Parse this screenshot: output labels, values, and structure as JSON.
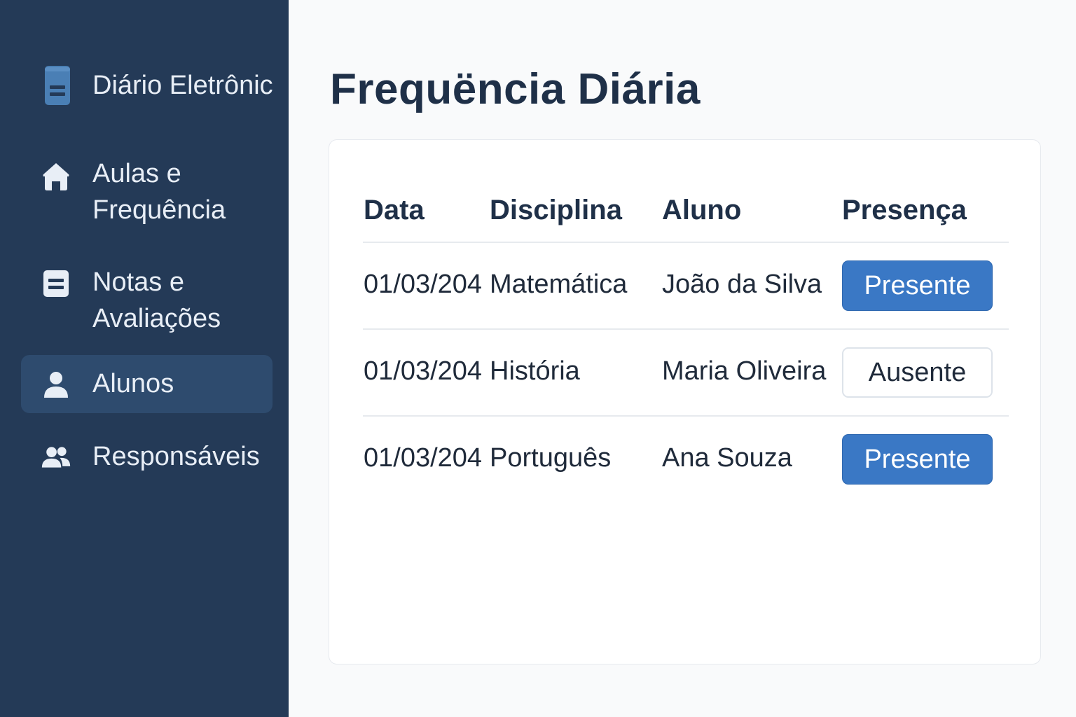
{
  "sidebar": {
    "brand": {
      "title": "Diário Eletrônic",
      "icon": "notebook-icon"
    },
    "items": [
      {
        "lines": [
          "Aulas e",
          "Frequência"
        ],
        "icon": "home-icon",
        "active": false
      },
      {
        "lines": [
          "Notas e",
          "Avaliações"
        ],
        "icon": "document-list-icon",
        "active": false
      },
      {
        "lines": [
          "Alunos"
        ],
        "icon": "user-icon",
        "active": true
      },
      {
        "lines": [
          "Responsáveis"
        ],
        "icon": "users-icon",
        "active": false
      }
    ]
  },
  "main": {
    "title": "Frequëncia Diária",
    "table": {
      "headers": [
        "Data",
        "Disciplina",
        "Aluno",
        "Presença"
      ],
      "rows": [
        {
          "date": "01/03/204",
          "subject": "Matemática",
          "student": "João da Silva",
          "status": "Presente",
          "status_type": "present"
        },
        {
          "date": "01/03/204",
          "subject": "História",
          "student": "Maria Oliveira",
          "status": "Ausente",
          "status_type": "absent"
        },
        {
          "date": "01/03/204",
          "subject": "Português",
          "student": "Ana Souza",
          "status": "Presente",
          "status_type": "present"
        }
      ]
    }
  },
  "colors": {
    "sidebar_bg": "#243a57",
    "sidebar_active": "#2e4b6e",
    "accent": "#3a78c5",
    "title": "#1f3048"
  }
}
